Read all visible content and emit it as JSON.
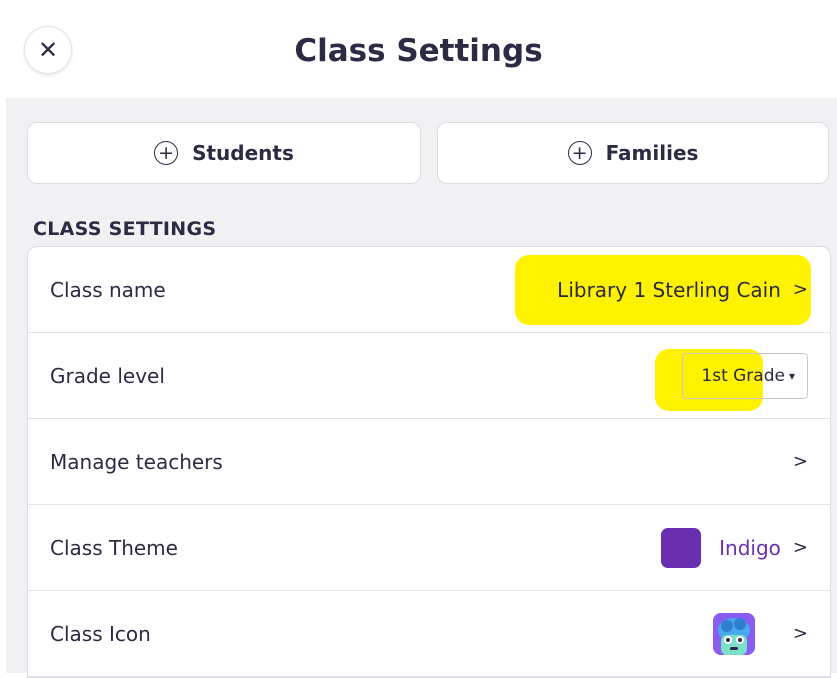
{
  "header": {
    "close_icon": "✕",
    "title": "Class Settings"
  },
  "actions": {
    "students_label": "Students",
    "families_label": "Families",
    "plus_icon": "+"
  },
  "section": {
    "label": "CLASS SETTINGS"
  },
  "settings": {
    "class_name": {
      "label": "Class name",
      "value": "Library 1 Sterling Cain",
      "chevron": ">"
    },
    "grade_level": {
      "label": "Grade level",
      "value": "1st Grade",
      "caret": "▾"
    },
    "manage_teachers": {
      "label": "Manage teachers",
      "chevron": ">"
    },
    "class_theme": {
      "label": "Class Theme",
      "value": "Indigo",
      "chevron": ">",
      "color": "#6a2fb0"
    },
    "class_icon": {
      "label": "Class Icon",
      "chevron": ">",
      "icon": "monster-icon"
    }
  },
  "colors": {
    "highlight": "#fff200",
    "theme_text": "#6a2fb0"
  }
}
